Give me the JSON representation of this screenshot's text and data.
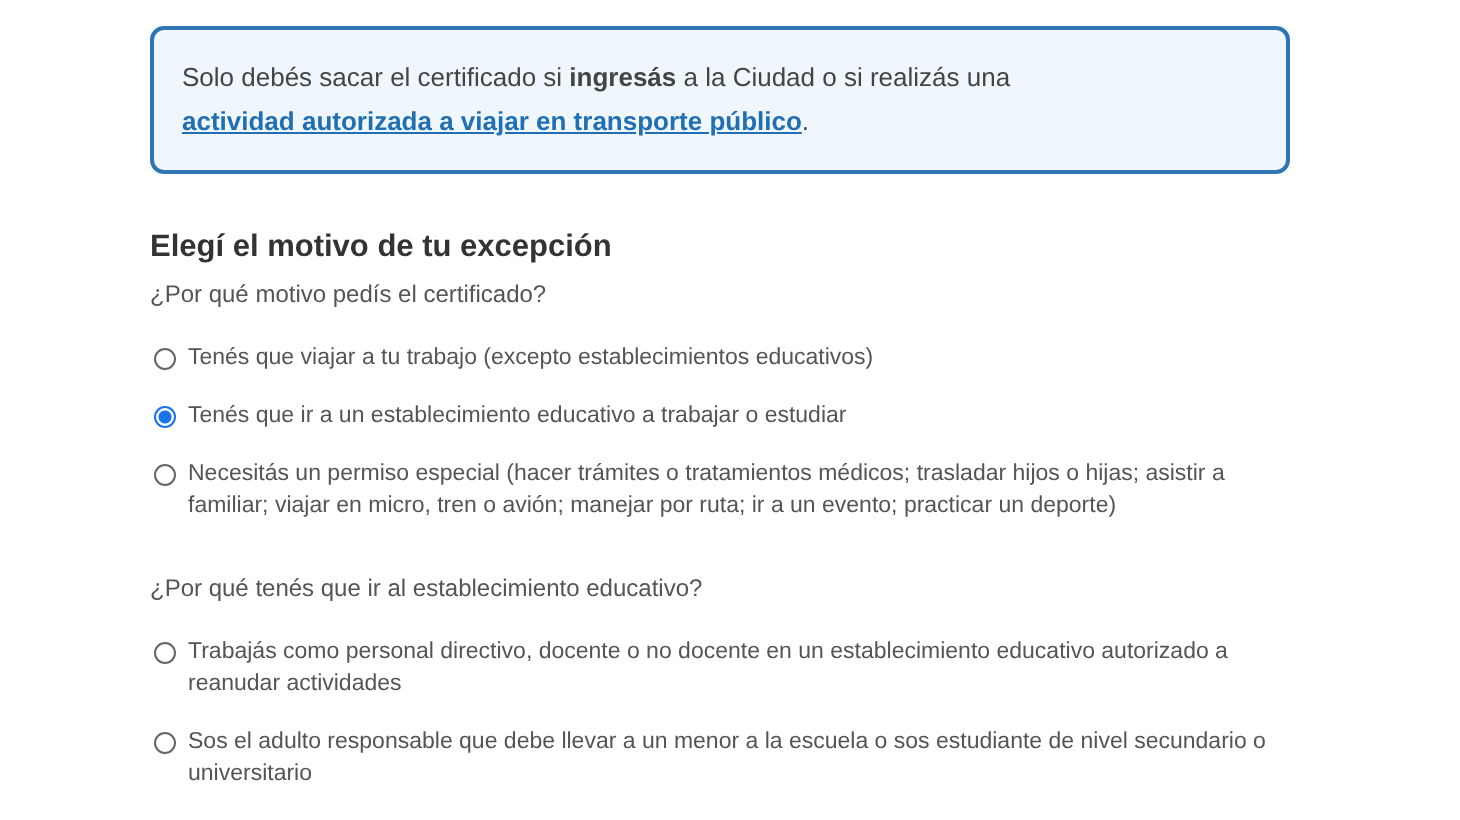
{
  "notice": {
    "text": "Solo debés sacar el certificado si **ingresás** a la Ciudad o si realizás una ",
    "link": "actividad autorizada a viajar en transporte público",
    "after": "."
  },
  "section": {
    "title": "Elegí el motivo de tu excepción",
    "questions": [
      {
        "label": "¿Por qué motivo pedís el certificado?",
        "options": [
          {
            "label": "Tenés que viajar a tu trabajo (excepto establecimientos educativos)",
            "selected": false
          },
          {
            "label": "Tenés que ir a un establecimiento educativo a trabajar o estudiar",
            "selected": true
          },
          {
            "label": "Necesitás un permiso especial (hacer trámites o tratamientos médicos; trasladar hijos o hijas; asistir a familiar; viajar en micro, tren o avión; manejar por ruta; ir a un evento; practicar un deporte)",
            "selected": false
          }
        ]
      },
      {
        "label": "¿Por qué tenés que ir al establecimiento educativo?",
        "options": [
          {
            "label": "Trabajás como personal directivo, docente o no docente en un establecimiento educativo autorizado a reanudar actividades",
            "selected": false
          },
          {
            "label": "Sos el adulto responsable que debe llevar a un menor a la escuela o sos estudiante de nivel secundario o universitario",
            "selected": false
          }
        ]
      }
    ]
  }
}
